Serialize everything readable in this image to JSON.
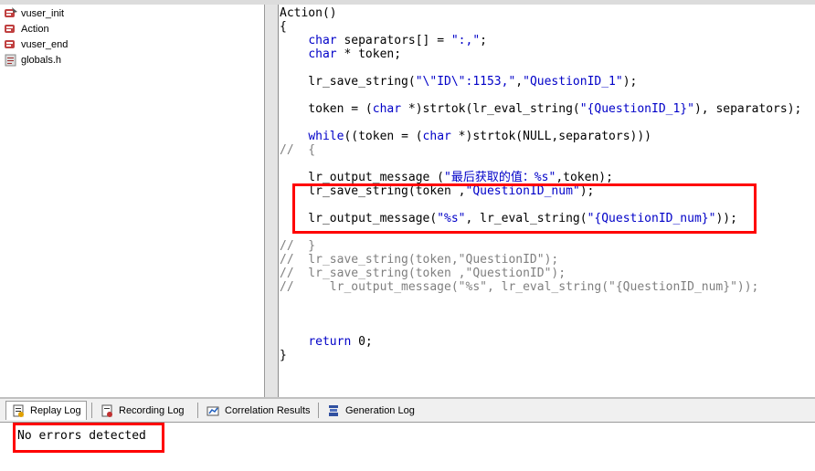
{
  "tree": {
    "items": [
      {
        "label": "vuser_init",
        "icon": "script-icon"
      },
      {
        "label": "Action",
        "icon": "script-icon"
      },
      {
        "label": "vuser_end",
        "icon": "script-icon"
      },
      {
        "label": "globals.h",
        "icon": "header-file-icon"
      }
    ]
  },
  "editor": {
    "lines": [
      "Action()",
      "{",
      "    char separators[] = \":,\";",
      "    char * token;",
      "",
      "    lr_save_string(\"\\\"ID\\\":1153,\",\"QuestionID_1\");",
      "",
      "    token = (char *)strtok(lr_eval_string(\"{QuestionID_1}\"), separators);",
      "",
      "    while((token = (char *)strtok(NULL,separators)))",
      "//  {",
      "",
      "    lr_output_message (\"最后获取的值：%s\",token);",
      "    lr_save_string(token ,\"QuestionID_num\");",
      "",
      "    lr_output_message(\"%s\", lr_eval_string(\"{QuestionID_num}\"));",
      "",
      "//  }",
      "//  lr_save_string(token,\"QuestionID\");",
      "//  lr_save_string(token ,\"QuestionID\");",
      "//     lr_output_message(\"%s\", lr_eval_string(\"{QuestionID_num}\"));",
      "",
      "",
      "",
      "    return 0;",
      "}"
    ]
  },
  "tabs": [
    {
      "label": "Replay Log",
      "icon": "replay-log-icon",
      "active": true
    },
    {
      "label": "Recording Log",
      "icon": "recording-log-icon",
      "active": false
    },
    {
      "label": "Correlation Results",
      "icon": "correlation-icon",
      "active": false
    },
    {
      "label": "Generation Log",
      "icon": "generation-log-icon",
      "active": false
    }
  ],
  "log": {
    "text": "No errors detected"
  },
  "colors": {
    "highlight": "#ff0000",
    "keyword": "#0000c8",
    "comment": "#7f7f7f"
  }
}
